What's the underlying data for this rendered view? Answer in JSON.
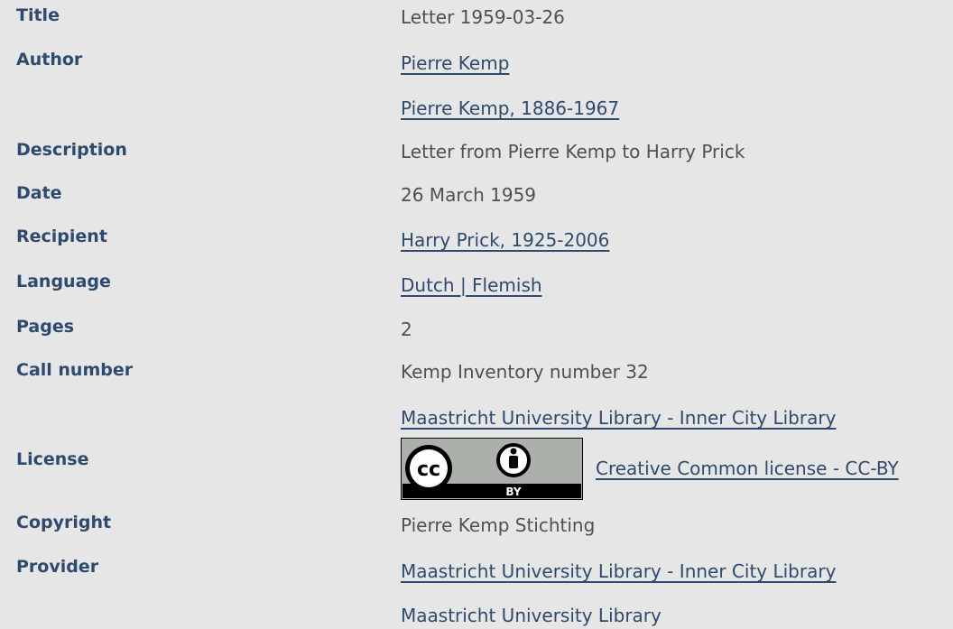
{
  "labels": {
    "title": "Title",
    "author": "Author",
    "description": "Description",
    "date": "Date",
    "recipient": "Recipient",
    "language": "Language",
    "pages": "Pages",
    "call_number": "Call number",
    "license": "License",
    "copyright": "Copyright",
    "provider": "Provider"
  },
  "values": {
    "title": "Letter 1959-03-26",
    "author_1": "Pierre Kemp",
    "author_2": "Pierre Kemp, 1886-1967",
    "description": "Letter from Pierre Kemp to Harry Prick",
    "date": "26 March 1959",
    "recipient": "Harry Prick, 1925-2006",
    "language": "Dutch | Flemish",
    "pages": "2",
    "call_number": "Kemp Inventory number 32",
    "call_number_link": "Maastricht University Library - Inner City Library",
    "license_link": "Creative Common license - CC-BY",
    "copyright": "Pierre Kemp Stichting",
    "provider_link": "Maastricht University Library - Inner City Library",
    "provider_2": "Maastricht University Library"
  },
  "license_badge": {
    "icon": "cc-by-icon",
    "cc_text": "cc",
    "by_text": "BY",
    "background": "#abb1aa"
  },
  "colors": {
    "label": "#2e4a6e",
    "text": "#505050",
    "link": "#2e4a6e",
    "background": "#e6e6e6"
  }
}
